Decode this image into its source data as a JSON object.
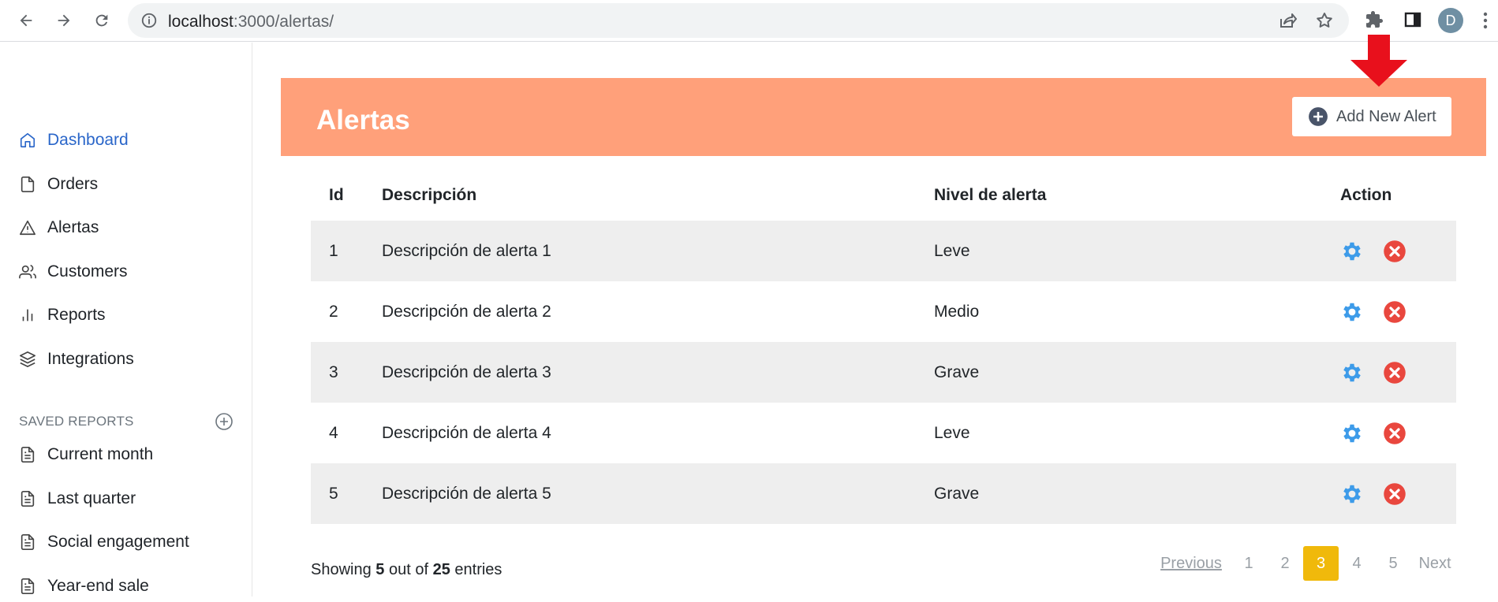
{
  "browser": {
    "url_host": "localhost",
    "url_path": ":3000/alertas/",
    "avatar_letter": "D"
  },
  "sidebar": {
    "items": [
      {
        "label": "Dashboard",
        "icon": "home-icon",
        "active": true
      },
      {
        "label": "Orders",
        "icon": "file-icon"
      },
      {
        "label": "Alertas",
        "icon": "alert-triangle-icon"
      },
      {
        "label": "Customers",
        "icon": "users-icon"
      },
      {
        "label": "Reports",
        "icon": "bar-chart-icon"
      },
      {
        "label": "Integrations",
        "icon": "layers-icon"
      }
    ],
    "saved_header": "SAVED REPORTS",
    "saved": [
      {
        "label": "Current month",
        "icon": "file-text-icon"
      },
      {
        "label": "Last quarter",
        "icon": "file-text-icon"
      },
      {
        "label": "Social engagement",
        "icon": "file-text-icon"
      },
      {
        "label": "Year-end sale",
        "icon": "file-text-icon"
      }
    ]
  },
  "header": {
    "title": "Alertas",
    "add_button": "Add New Alert",
    "color": "#ffa07a"
  },
  "table": {
    "columns": [
      "Id",
      "Descripción",
      "Nivel de alerta",
      "Action"
    ],
    "rows": [
      {
        "id": "1",
        "desc": "Descripción de alerta 1",
        "level": "Leve"
      },
      {
        "id": "2",
        "desc": "Descripción de alerta 2",
        "level": "Medio"
      },
      {
        "id": "3",
        "desc": "Descripción de alerta 3",
        "level": "Grave"
      },
      {
        "id": "4",
        "desc": "Descripción de alerta 4",
        "level": "Leve"
      },
      {
        "id": "5",
        "desc": "Descripción de alerta 5",
        "level": "Grave"
      }
    ]
  },
  "footer": {
    "showing_prefix": "Showing",
    "shown": "5",
    "middle": "out of",
    "total": "25",
    "suffix": "entries"
  },
  "pagination": {
    "previous": "Previous",
    "pages": [
      "1",
      "2",
      "3",
      "4",
      "5"
    ],
    "current": "3",
    "next": "Next"
  },
  "colors": {
    "accent": "#2a66c9",
    "edit": "#3d9be9",
    "delete": "#e9473e",
    "current_page": "#f0b90b"
  }
}
